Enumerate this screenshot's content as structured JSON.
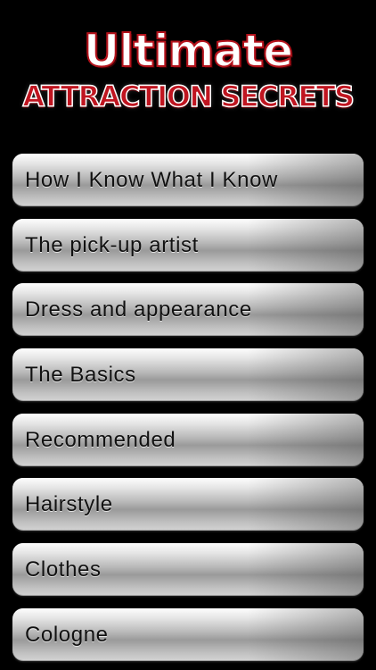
{
  "header": {
    "logo_line1": "Ultimate",
    "logo_line2": "ATTRACTION SECRETS"
  },
  "menu": {
    "items": [
      {
        "label": "How I Know What I Know"
      },
      {
        "label": "The pick-up artist"
      },
      {
        "label": "Dress and appearance"
      },
      {
        "label": "The Basics"
      },
      {
        "label": "Recommended"
      },
      {
        "label": "Hairstyle"
      },
      {
        "label": "Clothes"
      },
      {
        "label": "Cologne"
      }
    ]
  },
  "colors": {
    "background": "#000000",
    "logo_red": "#c01520",
    "button_silver": "#b9b9b9",
    "label_text": "#111111"
  }
}
